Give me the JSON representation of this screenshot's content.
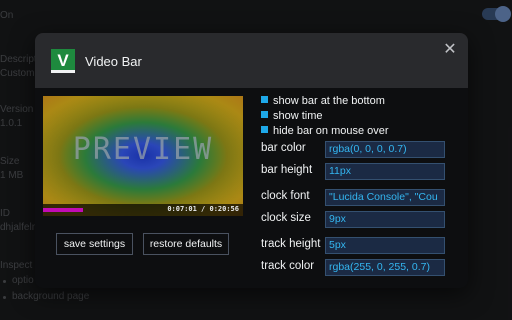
{
  "background": {
    "fragments": [
      "On",
      "Descripti",
      "Customi",
      "Version",
      "1.0.1",
      "Size",
      "1 MB",
      "ID",
      "dhjalfeln",
      "Inspect vi",
      "optio",
      "background page"
    ]
  },
  "dialog": {
    "logo_letter": "V",
    "title": "Video Bar",
    "close_glyph": "✕",
    "preview": {
      "label": "PREVIEW",
      "time": "0:07:01 / 0:20:56",
      "progress": 0.2
    },
    "buttons": {
      "save": "save settings",
      "restore": "restore defaults"
    },
    "options": [
      {
        "label": "show bar at the bottom",
        "checked": true
      },
      {
        "label": "show time",
        "checked": true
      },
      {
        "label": "hide bar on mouse over",
        "checked": true
      }
    ],
    "fields": [
      {
        "label": "bar color",
        "value": "rgba(0, 0, 0, 0.7)"
      },
      {
        "label": "bar height",
        "value": "11px"
      },
      {
        "label": "clock font",
        "value": "\"Lucida Console\", \"Cou"
      },
      {
        "label": "clock size",
        "value": "9px"
      },
      {
        "label": "track height",
        "value": "5px"
      },
      {
        "label": "track color",
        "value": "rgba(255, 0, 255, 0.7)"
      }
    ]
  },
  "colors": {
    "accent": "#34b6f0",
    "checkbox": "#1ea8e8",
    "logo": "#1e8a3e",
    "track": "#ff00ff"
  }
}
